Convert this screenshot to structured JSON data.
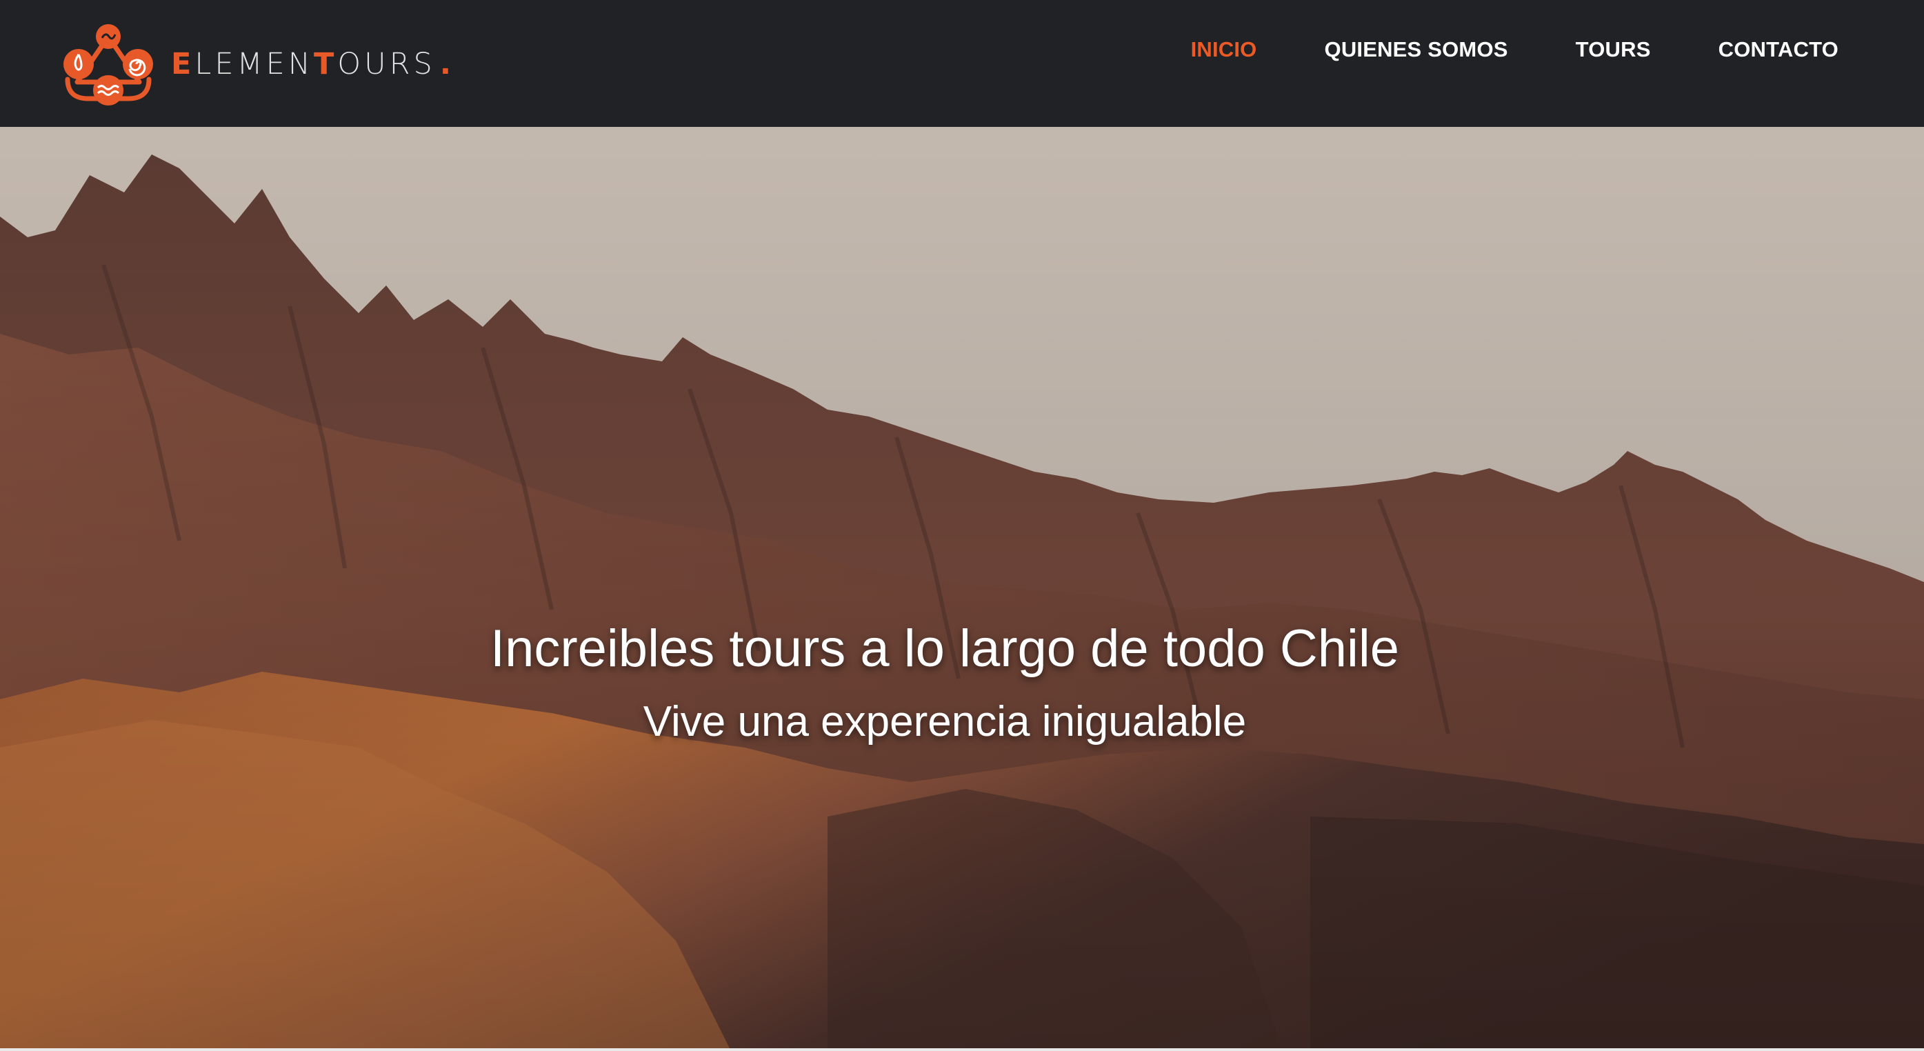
{
  "brand": {
    "name_parts": [
      "E",
      "LEMEN",
      "T",
      "OURS",
      "."
    ],
    "logo_icon": "elements-triangle-logo-icon",
    "accent_color": "#ec5b26"
  },
  "nav": {
    "items": [
      {
        "label": "INICIO",
        "active": true
      },
      {
        "label": "QUIENES SOMOS",
        "active": false
      },
      {
        "label": "TOURS",
        "active": false
      },
      {
        "label": "CONTACTO",
        "active": false
      }
    ]
  },
  "hero": {
    "title": "Increibles tours a lo largo de todo Chile",
    "subtitle": "Vive una experencia inigualable",
    "background": "mountain-range-at-sunset-image"
  },
  "colors": {
    "navbar_bg": "#212226",
    "nav_text": "#ffffff",
    "nav_active": "#ec5b26",
    "sky": "#cfc3b9"
  }
}
